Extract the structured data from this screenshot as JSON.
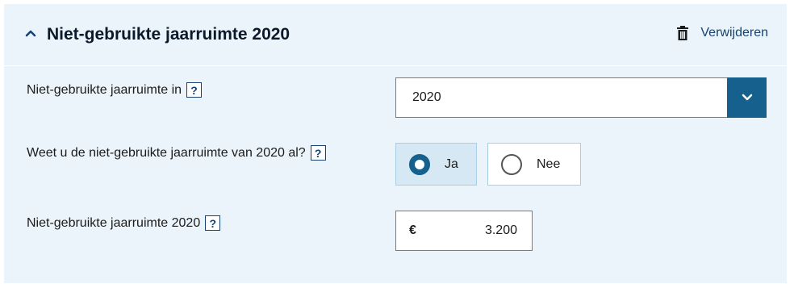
{
  "section": {
    "title": "Niet-gebruikte jaarruimte 2020",
    "delete_label": "Verwijderen"
  },
  "fields": {
    "year": {
      "label": "Niet-gebruikte jaarruimte in",
      "help": "?",
      "selected": "2020"
    },
    "known": {
      "label": "Weet u de niet-gebruikte jaarruimte van 2020 al?",
      "help": "?",
      "options": [
        {
          "label": "Ja",
          "checked": true
        },
        {
          "label": "Nee",
          "checked": false
        }
      ]
    },
    "amount": {
      "label": "Niet-gebruikte jaarruimte 2020",
      "help": "?",
      "currency": "€",
      "value": "3.200"
    }
  },
  "colors": {
    "panel_background": "#ebf4fa",
    "accent": "#15608c",
    "link": "#154273"
  },
  "icons": {
    "collapse": "chevron-up-icon",
    "delete": "trash-icon",
    "dropdown": "chevron-down-icon"
  }
}
